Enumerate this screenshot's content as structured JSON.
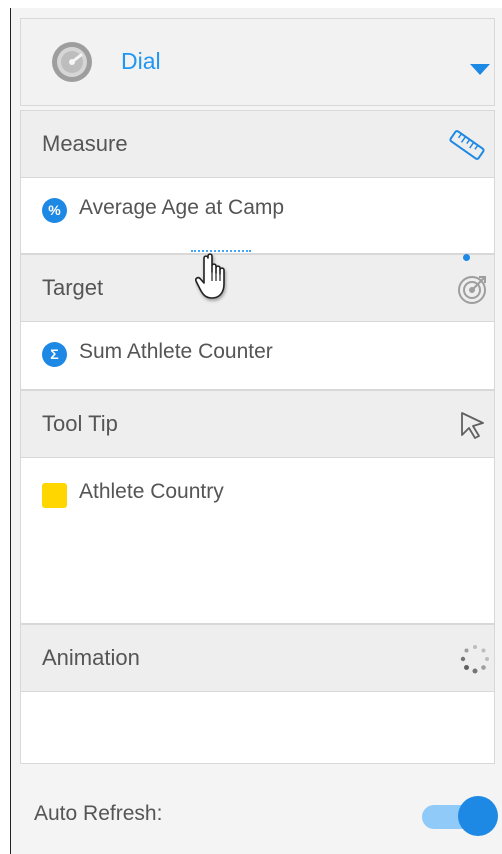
{
  "chart_type": {
    "label": "Dial",
    "icon": "dial-gauge-icon",
    "dropdown_icon": "chevron-down-icon"
  },
  "sections": [
    {
      "title": "Measure",
      "icon": "ruler-icon",
      "fields": [
        {
          "badge": "%",
          "label": "Average Age at Camp",
          "badge_color": "#1e88e5"
        }
      ]
    },
    {
      "title": "Target",
      "icon": "target-icon",
      "fields": [
        {
          "badge": "Σ",
          "label": "Sum Athlete Counter",
          "badge_color": "#1e88e5"
        }
      ]
    },
    {
      "title": "Tool Tip",
      "icon": "pointer-arrow-icon",
      "fields": [
        {
          "badge": "",
          "label": "Athlete Country",
          "badge_color": "#ffd600"
        }
      ]
    },
    {
      "title": "Animation",
      "icon": "spinner-icon",
      "fields": []
    }
  ],
  "auto_refresh": {
    "label": "Auto Refresh:",
    "enabled": true
  },
  "colors": {
    "accent": "#1e88e5",
    "accent_light": "#90caf9",
    "tooltip_swatch": "#ffd600"
  },
  "cursor": "hand-pointer-icon"
}
